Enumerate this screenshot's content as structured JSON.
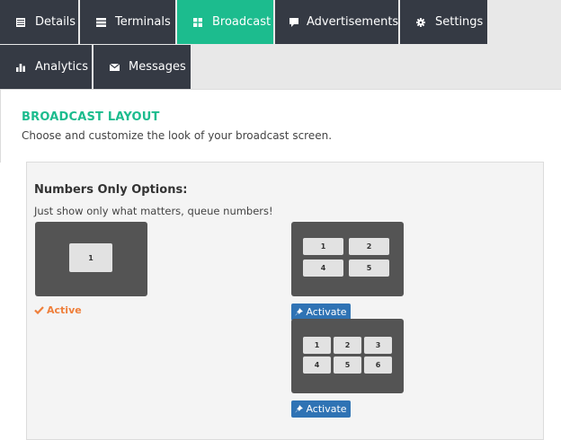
{
  "tabs": [
    {
      "label": "Details",
      "icon": "list-icon",
      "active": false
    },
    {
      "label": "Terminals",
      "icon": "server-icon",
      "active": false
    },
    {
      "label": "Broadcast",
      "icon": "grid-icon",
      "active": true
    },
    {
      "label": "Advertisements",
      "icon": "comment-icon",
      "active": false
    },
    {
      "label": "Settings",
      "icon": "gear-icon",
      "active": false
    },
    {
      "label": "Analytics",
      "icon": "bar-chart-icon",
      "active": false
    },
    {
      "label": "Messages",
      "icon": "envelope-icon",
      "active": false
    }
  ],
  "section": {
    "title": "BROADCAST LAYOUT",
    "subtitle": "Choose and customize the look of your broadcast screen."
  },
  "options": {
    "title": "Numbers Only Options:",
    "description": "Just show only what matters, queue numbers!",
    "layouts": [
      {
        "cells": [
          "1"
        ],
        "status": "Active"
      },
      {
        "cells": [
          "1",
          "2",
          "4",
          "5"
        ],
        "button": "Activate"
      },
      {
        "cells": [
          "1",
          "2",
          "3",
          "4",
          "5",
          "6"
        ],
        "button": "Activate"
      }
    ]
  },
  "colors": {
    "accent": "#1cbc8e",
    "tab_bg": "#353a44",
    "active_status": "#ef7f3b",
    "button": "#2f73b4"
  }
}
